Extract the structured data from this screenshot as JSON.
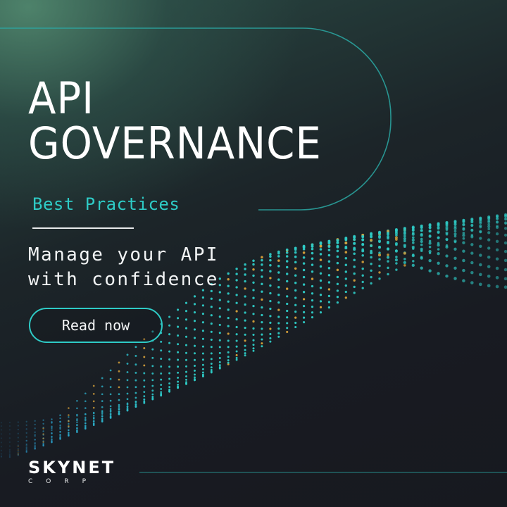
{
  "headline": {
    "line1": "API",
    "line2": "GOVERNANCE"
  },
  "subtitle": "Best Practices",
  "tagline": {
    "line1": "Manage your API",
    "line2": "with confidence"
  },
  "cta": {
    "label": "Read now"
  },
  "logo": {
    "main": "SKYNET",
    "sub": "CORP"
  },
  "colors": {
    "accent": "#2ecbc6",
    "background": "#181a21",
    "text": "#ffffff",
    "particle_gold": "#d9a23a",
    "particle_blue": "#2a8fd0"
  },
  "decoration": {
    "particle_wave": "dotted particle wave graphic",
    "frame": "rounded outline frame"
  }
}
